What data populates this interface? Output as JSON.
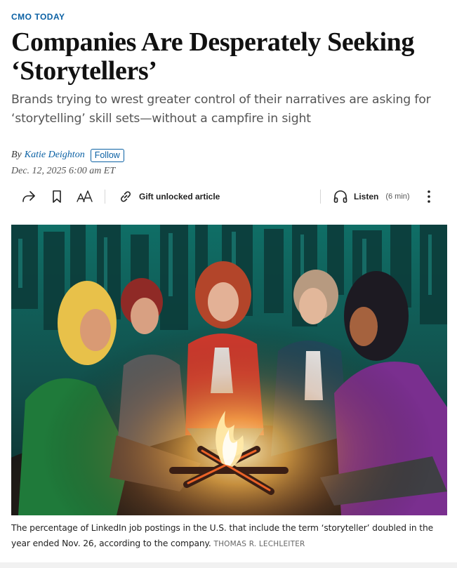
{
  "article": {
    "kicker": "CMO TODAY",
    "headline": "Companies Are Desperately Seeking ‘Storytellers’",
    "dek": "Brands trying to wrest greater control of their narratives are asking for ‘storytelling’ skill sets—without a campfire in sight",
    "byline_prefix": "By",
    "author": "Katie Deighton",
    "follow_label": "Follow",
    "dateline": "Dec. 12, 2025 6:00 am ET"
  },
  "toolbar": {
    "share_icon": "share-icon",
    "bookmark_icon": "bookmark-icon",
    "text_size_icon": "text-size-icon",
    "gift_icon": "link-icon",
    "gift_label": "Gift unlocked article",
    "listen_icon": "headphones-icon",
    "listen_label": "Listen",
    "listen_duration": "(6 min)",
    "more_icon": "more-vertical-icon"
  },
  "image": {
    "caption": "The percentage of LinkedIn job postings in the U.S. that include the term ‘storyteller’ doubled in the year ended Nov. 26, according to the company.",
    "credit": "THOMAS R. LECHLEITER"
  },
  "colors": {
    "link_blue": "#0b61a4",
    "hero_teal": "#0f6e66",
    "fire_orange": "#f08a2c"
  }
}
